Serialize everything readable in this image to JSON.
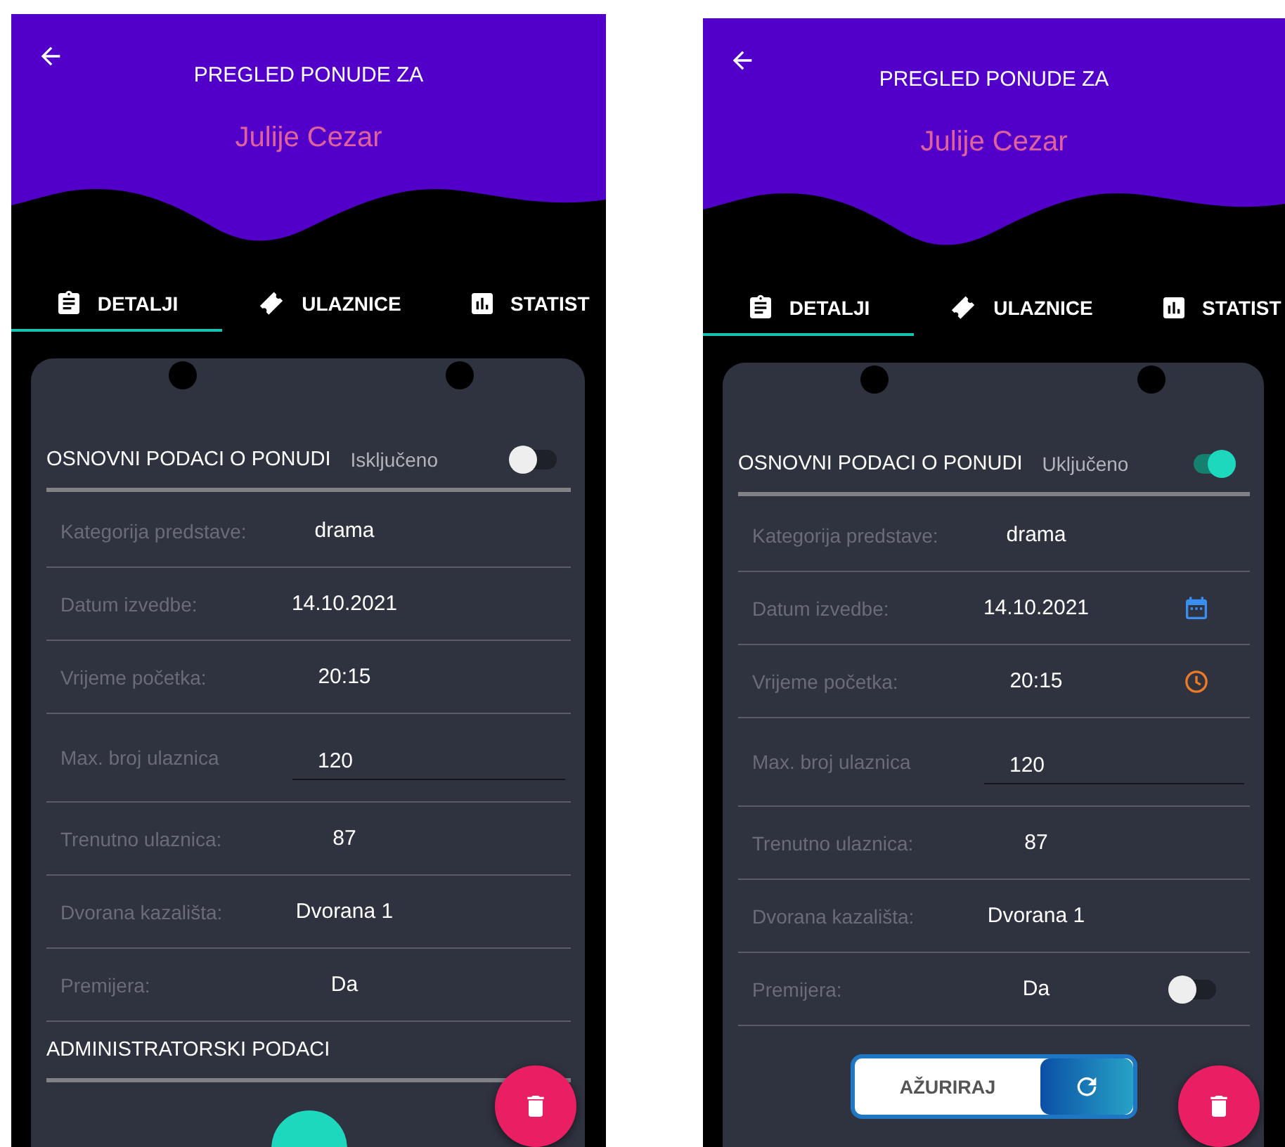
{
  "screens": [
    {
      "title": "PREGLED PONUDE ZA",
      "subtitle": "Julije Cezar",
      "tabs": [
        {
          "label": "DETALJI",
          "selected": true,
          "kind": "clipboard"
        },
        {
          "label": "ULAZNICE",
          "selected": false,
          "kind": "ticket"
        },
        {
          "label": "STATIST",
          "selected": false,
          "kind": "chart"
        }
      ],
      "sections": [
        {
          "title": "OSNOVNI PODACI O PONUDI",
          "status": "Isključeno",
          "on": false,
          "rows": [
            {
              "kind": "text",
              "label": "Kategorija predstave:",
              "value": "drama"
            },
            {
              "kind": "text",
              "label": "Datum izvedbe:",
              "value": "14.10.2021"
            },
            {
              "kind": "text",
              "label": "Vrijeme početka:",
              "value": "20:15"
            },
            {
              "kind": "input",
              "label": "Max. broj ulaznica",
              "value": "120"
            },
            {
              "kind": "text",
              "label": "Trenutno ulaznica:",
              "value": "87"
            },
            {
              "kind": "text",
              "label": "Dvorana kazališta:",
              "value": "Dvorana 1"
            },
            {
              "kind": "text",
              "label": "Premijera:",
              "value": "Da"
            }
          ]
        },
        {
          "title": "ADMINISTRATORSKI PODACI"
        }
      ],
      "footer": {
        "kind": "circle"
      }
    },
    {
      "title": "PREGLED PONUDE ZA",
      "subtitle": "Julije Cezar",
      "tabs": [
        {
          "label": "DETALJI",
          "selected": true,
          "kind": "clipboard"
        },
        {
          "label": "ULAZNICE",
          "selected": false,
          "kind": "ticket"
        },
        {
          "label": "STATIST",
          "selected": false,
          "kind": "chart"
        }
      ],
      "sections": [
        {
          "title": "OSNOVNI PODACI O PONUDI",
          "status": "Uključeno",
          "on": true,
          "rows": [
            {
              "kind": "text",
              "label": "Kategorija predstave:",
              "value": "drama"
            },
            {
              "kind": "date",
              "label": "Datum izvedbe:",
              "value": "14.10.2021"
            },
            {
              "kind": "time",
              "label": "Vrijeme početka:",
              "value": "20:15"
            },
            {
              "kind": "input",
              "label": "Max. broj ulaznica",
              "value": "120"
            },
            {
              "kind": "text",
              "label": "Trenutno ulaznica:",
              "value": "87"
            },
            {
              "kind": "text",
              "label": "Dvorana kazališta:",
              "value": "Dvorana 1"
            },
            {
              "kind": "switch",
              "label": "Premijera:",
              "value": "Da",
              "on": false
            }
          ]
        }
      ],
      "footer": {
        "kind": "pill",
        "label": "AŽURIRAJ"
      }
    }
  ]
}
